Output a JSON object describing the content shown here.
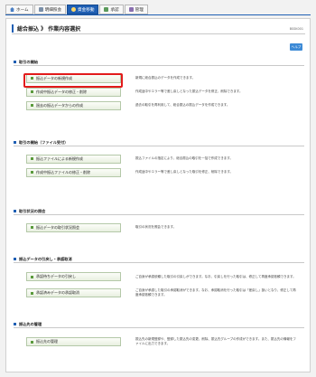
{
  "tabs": [
    {
      "label": "ホーム",
      "icon": "home-icon",
      "active": false
    },
    {
      "label": "明細照会",
      "icon": "inquiry-icon",
      "active": false
    },
    {
      "label": "資金移動",
      "icon": "fund-transfer-icon",
      "active": true
    },
    {
      "label": "承認",
      "icon": "approval-icon",
      "active": false
    },
    {
      "label": "管理",
      "icon": "management-icon",
      "active": false
    }
  ],
  "page": {
    "title": "総合振込 》 作業内容選択",
    "code": "BSSK001",
    "help_label": "ヘルプ"
  },
  "sections": [
    {
      "heading": "取引の開始",
      "items": [
        {
          "label": "振込データの新規作成",
          "desc": "新規に総合振込のデータを作成できます。"
        },
        {
          "label": "作成中振込データの修正・削除",
          "desc": "作成途中やエラー等で差し戻しとなった振込データを修正、削除できます。"
        },
        {
          "label": "過去の振込データからの作成",
          "desc": "過去の取引を再利用して、総合振込の振込データを作成できます。"
        }
      ]
    },
    {
      "heading": "取引の開始（ファイル受付）",
      "items": [
        {
          "label": "振込ファイルによる新規作成",
          "desc": "振込ファイルの指定により、総合振込の取引を一括で作成できます。"
        },
        {
          "label": "作成中振込ファイルの修正・削除",
          "desc": "作成途中やエラー等で差し戻しとなった取引を修正、削除できます。"
        }
      ]
    },
    {
      "heading": "取引状況の照会",
      "items": [
        {
          "label": "振込データの取引状況照会",
          "desc": "取引の状況を照会できます。"
        }
      ]
    },
    {
      "heading": "振込データの引戻し・承認取消",
      "items": [
        {
          "label": "承認待ちデータの引戻し",
          "desc": "ご自身が承認依頼した取引の引戻しができます。なお、引戻しを行った取引は、修正して再度承認依頼できます。"
        },
        {
          "label": "承認済みデータの承認取消",
          "desc": "ご自身が承認した取引の承認取消ができます。なお、承認取消を行った取引は「差戻し」扱いとなり、修正して再度承認依頼できます。"
        }
      ]
    },
    {
      "heading": "振込先の管理",
      "items": [
        {
          "label": "振込先の管理",
          "desc": "振込先の新規登録や、登録した振込先の変更、削除、振込先グループの作成ができます。また、振込先の情報をファイルに出力できます。"
        }
      ]
    }
  ],
  "colors": {
    "accent": "#1f5fb4",
    "highlight": "#e21b1b",
    "button_square": "#5a9a3c"
  }
}
